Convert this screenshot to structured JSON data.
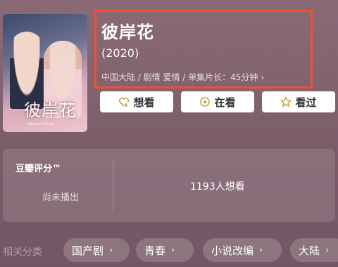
{
  "movie": {
    "title": "彼岸花",
    "year": "(2020)",
    "meta": "中国大陆 / 剧情 爱情 / 单集片长：45分钟",
    "meta_arrow": "›"
  },
  "poster": {
    "title_text": "彼岸花",
    "subtitle_text": "Equinox Flower"
  },
  "actions": {
    "want_label": "想看",
    "watching_label": "在看",
    "watched_label": "看过"
  },
  "rating": {
    "label": "豆瓣评分™",
    "status": "尚未播出",
    "want_count": "1193人想看"
  },
  "categories": {
    "label": "相关分类",
    "items": [
      {
        "label": "国产剧"
      },
      {
        "label": "青春"
      },
      {
        "label": "小说改编"
      },
      {
        "label": "大陆"
      }
    ],
    "chevron": "›"
  },
  "colors": {
    "highlight_border": "#f0522d",
    "background": "#7a5c69",
    "accent_icon": "#c8a23b"
  }
}
